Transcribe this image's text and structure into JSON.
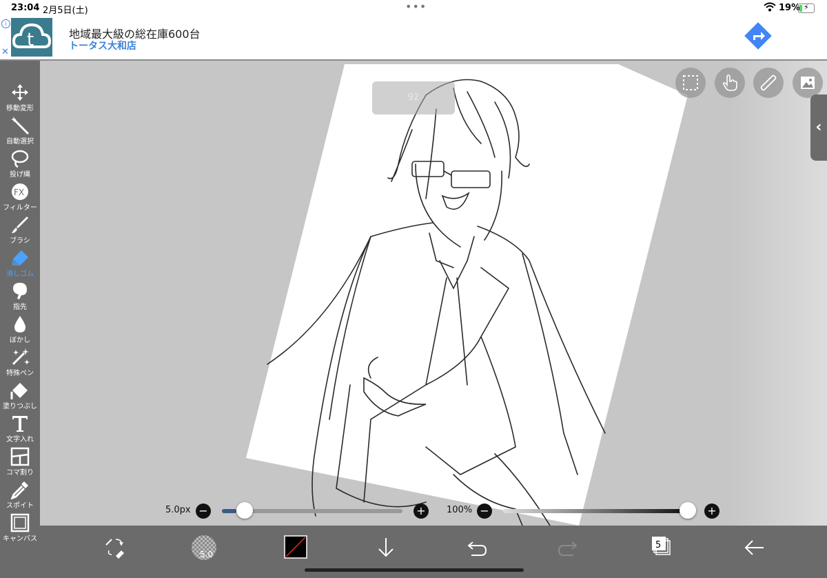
{
  "status": {
    "time": "23:04",
    "date": "2月5日(土)",
    "battery": "19%"
  },
  "ad": {
    "title": "地域最大級の総在庫600台",
    "subtitle": "トータス大和店",
    "close": "✕",
    "info": "i",
    "logo_letter": "t"
  },
  "tools": [
    {
      "label": "移動変形",
      "icon": "move-icon"
    },
    {
      "label": "自動選択",
      "icon": "magic-wand-icon"
    },
    {
      "label": "投げ縄",
      "icon": "lasso-icon"
    },
    {
      "label": "フィルター",
      "icon": "fx-icon"
    },
    {
      "label": "ブラシ",
      "icon": "brush-icon"
    },
    {
      "label": "消しゴム",
      "icon": "eraser-icon",
      "active": true
    },
    {
      "label": "指先",
      "icon": "finger-icon"
    },
    {
      "label": "ぼかし",
      "icon": "blur-icon"
    },
    {
      "label": "特殊ペン",
      "icon": "special-pen-icon"
    },
    {
      "label": "塗りつぶし",
      "icon": "fill-icon"
    },
    {
      "label": "文字入れ",
      "icon": "text-icon"
    },
    {
      "label": "コマ割り",
      "icon": "panel-icon"
    },
    {
      "label": "スポイト",
      "icon": "eyedropper-icon"
    },
    {
      "label": "キャンバス",
      "icon": "canvas-icon"
    }
  ],
  "canvas": {
    "zoom_badge": "92"
  },
  "brush": {
    "size_label": "5.0px",
    "size_fraction": 0.08,
    "opacity_label": "100%",
    "opacity_fraction": 1.0
  },
  "bottom": {
    "layer_count": "5",
    "brush_size_badge": "5.0"
  },
  "colors": {
    "toolbar": "#6b6b6b",
    "active": "#4aa3ff",
    "canvas_bg": "#c6c6c6"
  }
}
